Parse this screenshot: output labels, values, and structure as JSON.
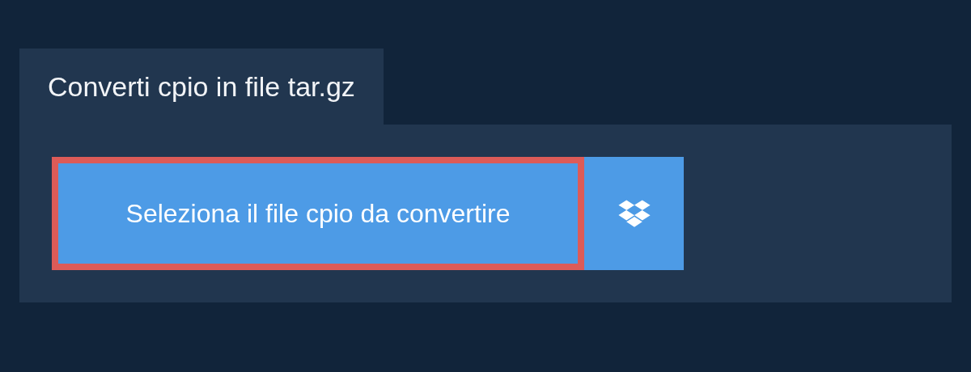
{
  "tab": {
    "label": "Converti cpio in file tar.gz",
    "selected": true
  },
  "select_button": {
    "label": "Seleziona il file cpio da convertire",
    "focused": true
  },
  "cloud_button": {
    "kind": "dropbox"
  }
}
